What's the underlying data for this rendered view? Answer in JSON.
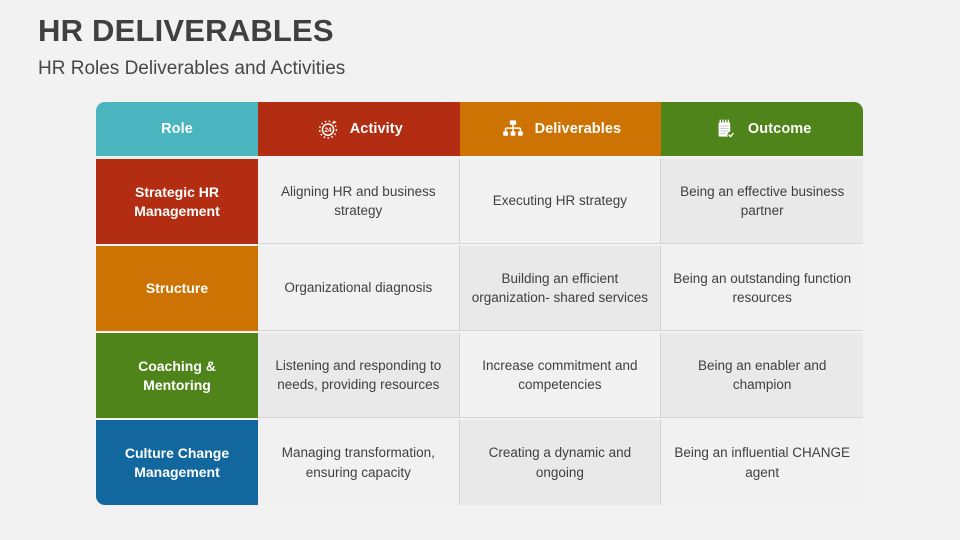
{
  "slide": {
    "title": "HR DELIVERABLES",
    "subtitle": "HR Roles Deliverables and Activities"
  },
  "colors": {
    "teal": "#4ab5bf",
    "red": "#b32d12",
    "orange": "#cd7304",
    "green": "#4e8419",
    "blue": "#12679e",
    "background": "#f2f2f2",
    "cell_shade_a": "#e9e9e9",
    "cell_shade_b": "#f1f1f1",
    "title_text": "#404040"
  },
  "table": {
    "headers": [
      {
        "label": "Role",
        "icon": "",
        "icon_name": "none"
      },
      {
        "label": "Activity",
        "icon": "clock-24-icon",
        "icon_name": "clock-24-icon"
      },
      {
        "label": "Deliverables",
        "icon": "org-chart-icon",
        "icon_name": "org-chart-icon"
      },
      {
        "label": "Outcome",
        "icon": "notepad-check-icon",
        "icon_name": "notepad-check-icon"
      }
    ],
    "rows": [
      {
        "role": "Strategic HR Management",
        "activity": "Aligning HR and business strategy",
        "deliverables": "Executing HR strategy",
        "outcome": "Being an effective business partner"
      },
      {
        "role": "Structure",
        "activity": "Organizational diagnosis",
        "deliverables": "Building an efficient organization- shared services",
        "outcome": "Being an outstanding function resources"
      },
      {
        "role": "Coaching & Mentoring",
        "activity": "Listening and responding to needs, providing resources",
        "deliverables": "Increase commitment and competencies",
        "outcome": "Being an enabler and champion"
      },
      {
        "role": "Culture Change Management",
        "activity": "Managing transformation, ensuring capacity",
        "deliverables": "Creating a dynamic and ongoing",
        "outcome": "Being an influential CHANGE agent"
      }
    ]
  }
}
